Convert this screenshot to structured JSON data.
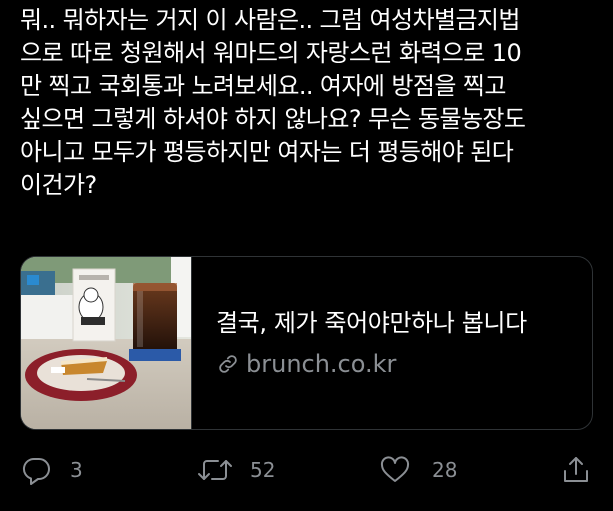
{
  "tweet": {
    "lines": [
      "뭐.. 뭐하자는 거지 이 사람은.. 그럼 여성차별금지법",
      "으로 따로 청원해서 워마드의 자랑스런 화력으로 10",
      "만 찍고 국회통과 노려보세요.. 여자에 방점을 찍고",
      "싶으면 그렇게 하셔야 하지 않나요? 무슨 동물농장도",
      "아니고 모두가 평등하지만 여자는 더 평등해야 된다",
      "이건가?"
    ]
  },
  "card": {
    "title": "결국, 제가 죽어야만하나 봅니다",
    "domain": "brunch.co.kr",
    "domain_icon": "link-icon",
    "thumbnail": "cafe-photo-with-cake-and-iced-coffee"
  },
  "actions": {
    "reply": {
      "icon": "reply-icon",
      "count": "3"
    },
    "retweet": {
      "icon": "retweet-icon",
      "count": "52"
    },
    "like": {
      "icon": "heart-icon",
      "count": "28"
    },
    "share": {
      "icon": "share-icon"
    }
  },
  "colors": {
    "background": "#000000",
    "text": "#ffffff",
    "secondary_text": "#8b8f94",
    "border": "#2f3336"
  }
}
